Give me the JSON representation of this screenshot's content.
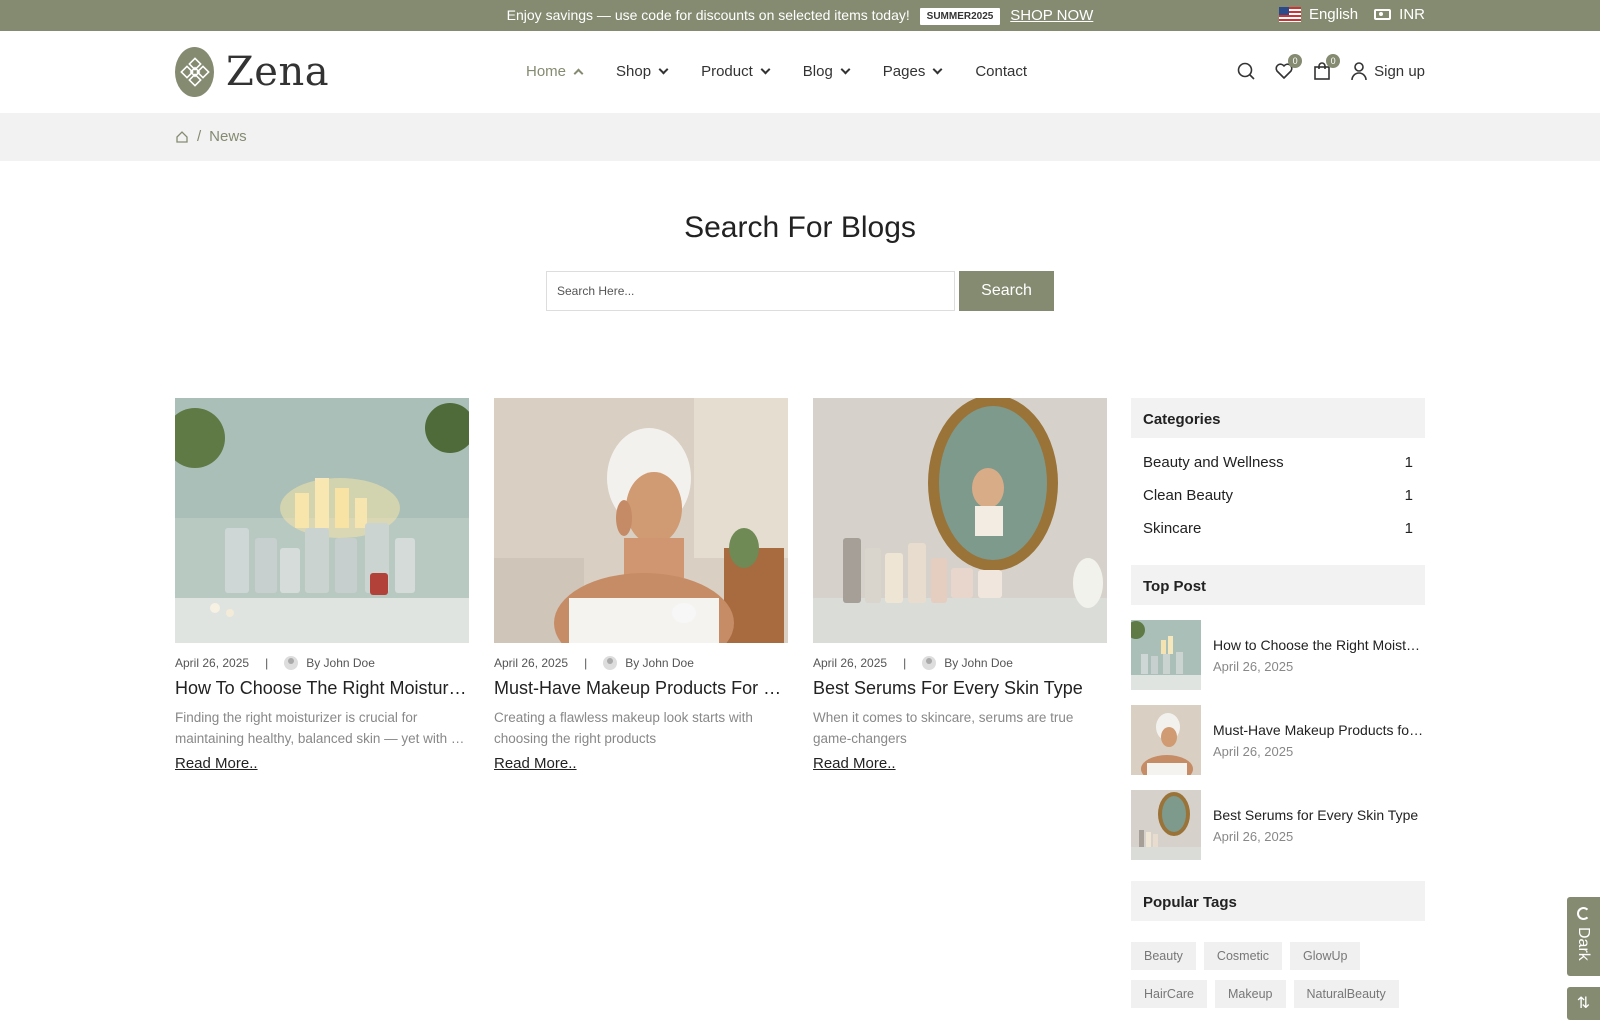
{
  "topbar": {
    "promo_text": "Enjoy savings — use code for discounts on selected items today!",
    "code": "SUMMER2025",
    "shop_now": "SHOP NOW",
    "language": "English",
    "currency": "INR"
  },
  "brand": {
    "name": "Zena",
    "accent": "#848b71"
  },
  "nav": {
    "items": [
      {
        "label": "Home",
        "state": "active",
        "icon": "chevron-up-icon"
      },
      {
        "label": "Shop",
        "icon": "chevron-down-icon"
      },
      {
        "label": "Product",
        "icon": "chevron-down-icon"
      },
      {
        "label": "Blog",
        "icon": "chevron-down-icon"
      },
      {
        "label": "Pages",
        "icon": "chevron-down-icon"
      },
      {
        "label": "Contact"
      }
    ]
  },
  "header_actions": {
    "wishlist_count": "0",
    "cart_count": "0",
    "signup_label": "Sign up"
  },
  "breadcrumb": {
    "current": "News"
  },
  "search": {
    "title": "Search For Blogs",
    "placeholder": "Search Here...",
    "button": "Search"
  },
  "posts": [
    {
      "date": "April 26, 2025",
      "author": "By John Doe",
      "title": "How To Choose The Right Moisturizer For Your Skin Type",
      "excerpt_line1": "Finding the right moisturizer is crucial for",
      "excerpt_line2": "maintaining healthy, balanced skin — yet with so many options",
      "read_more": "Read More.."
    },
    {
      "date": "April 26, 2025",
      "author": "By John Doe",
      "title": "Must-Have Makeup Products For Beginners",
      "excerpt_line1": "Creating a flawless makeup look starts with",
      "excerpt_line2": "choosing the right products",
      "read_more": "Read More.."
    },
    {
      "date": "April 26, 2025",
      "author": "By John Doe",
      "title": "Best Serums For Every Skin Type",
      "excerpt_line1": "When it comes to skincare, serums are true",
      "excerpt_line2": "game-changers",
      "read_more": "Read More.."
    }
  ],
  "sidebar": {
    "categories_title": "Categories",
    "categories": [
      {
        "name": "Beauty and Wellness",
        "count": "1"
      },
      {
        "name": "Clean Beauty",
        "count": "1"
      },
      {
        "name": "Skincare",
        "count": "1"
      }
    ],
    "top_post_title": "Top Post",
    "top_posts": [
      {
        "title": "How to Choose the Right Moisturizer for Your Skin Type",
        "date": "April 26, 2025"
      },
      {
        "title": "Must-Have Makeup Products for Beginners",
        "date": "April 26, 2025"
      },
      {
        "title": "Best Serums for Every Skin Type",
        "date": "April 26, 2025"
      }
    ],
    "tags_title": "Popular Tags",
    "tags": [
      "Beauty",
      "Cosmetic",
      "GlowUp",
      "HairCare",
      "Makeup",
      "NaturalBeauty"
    ]
  },
  "floating": {
    "dark_label": "Dark"
  }
}
